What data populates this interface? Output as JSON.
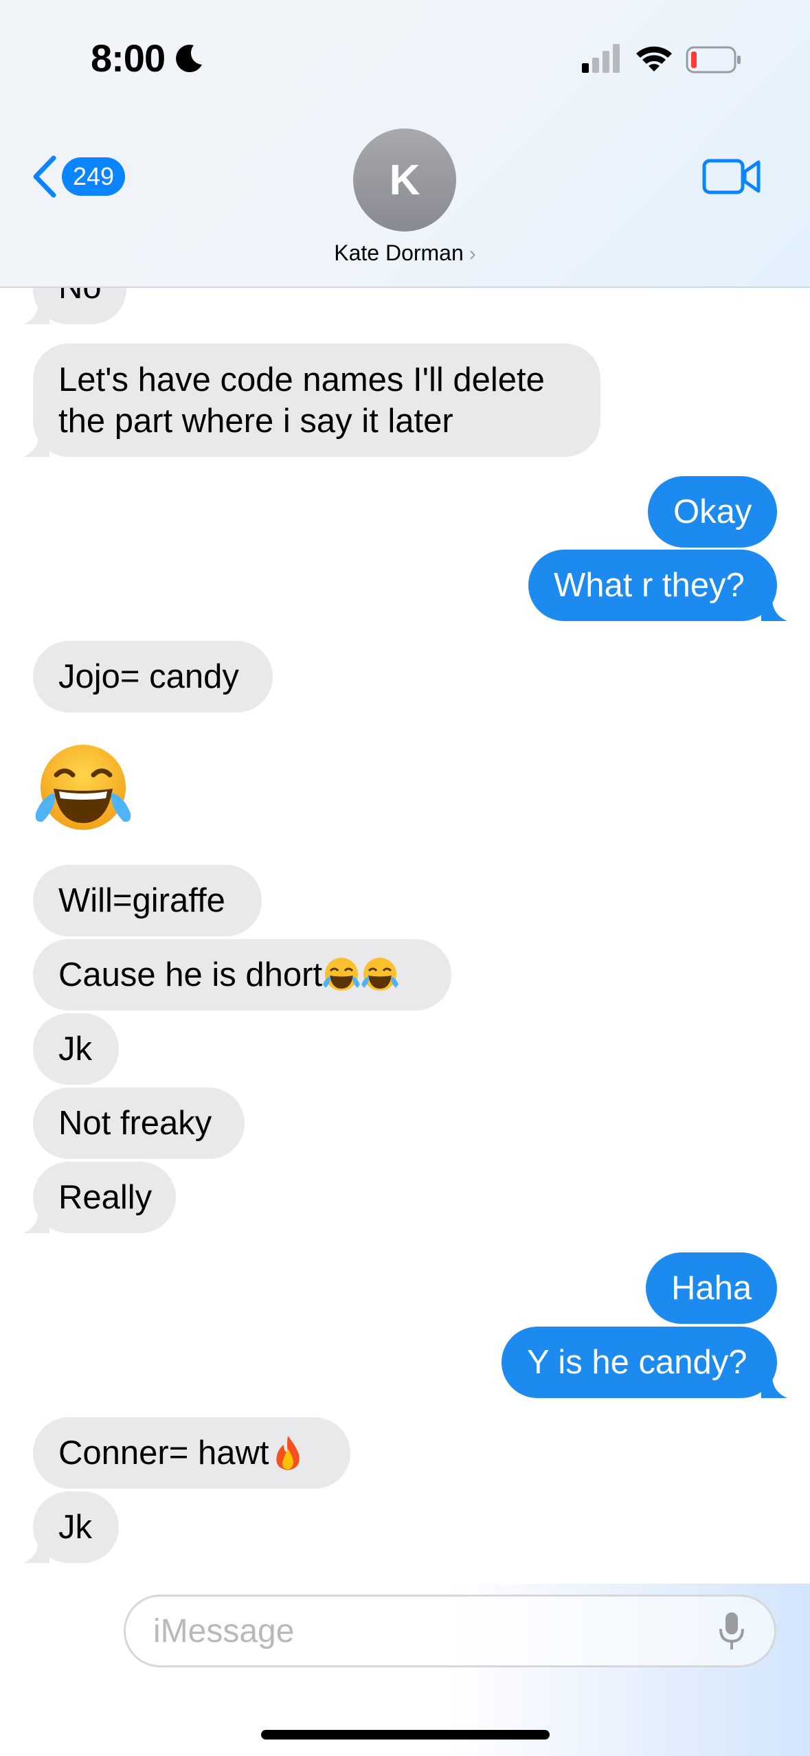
{
  "status_bar": {
    "time": "8:00",
    "focus_icon": "moon-icon",
    "battery_level": 0.1
  },
  "header": {
    "back_count": "249",
    "avatar_initial": "K",
    "contact_name": "Kate Dorman",
    "chevron": "›",
    "video_icon": "video-camera-icon"
  },
  "messages": [
    {
      "dir": "in",
      "text": "No"
    },
    {
      "dir": "in",
      "line1": "Let's have code names I'll delete",
      "line2": "the part where i say it later"
    },
    {
      "dir": "out",
      "text": "Okay"
    },
    {
      "dir": "out",
      "text": "What r they?"
    },
    {
      "dir": "in",
      "text": "Jojo= candy"
    },
    {
      "dir": "in",
      "emoji": "face-with-tears-of-joy"
    },
    {
      "dir": "in",
      "text": "Will=giraffe"
    },
    {
      "dir": "in",
      "text": "Cause he is dhort"
    },
    {
      "dir": "in",
      "text": "Jk"
    },
    {
      "dir": "in",
      "text": "Not freaky"
    },
    {
      "dir": "in",
      "text": "Really"
    },
    {
      "dir": "out",
      "text": "Haha"
    },
    {
      "dir": "out",
      "text": "Y is he candy?"
    },
    {
      "dir": "in",
      "text": "Conner= hawt"
    },
    {
      "dir": "in",
      "text": "Jk"
    }
  ],
  "composer": {
    "placeholder": "iMessage",
    "plus": "+"
  },
  "colors": {
    "accent": "#0a84ff",
    "sent": "#1d8af0",
    "received": "#e9e9eb"
  }
}
